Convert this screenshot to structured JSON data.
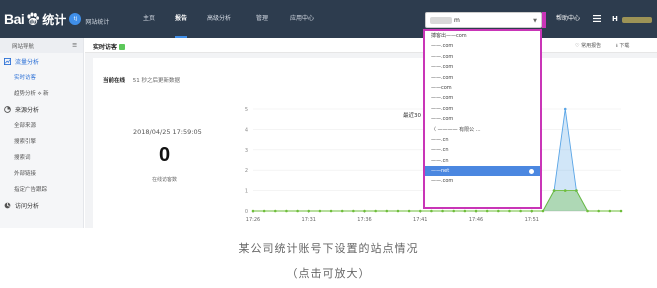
{
  "topbar": {
    "logo_text": "Bai",
    "logo_text2": "统计",
    "logo_badge": "tj",
    "logo_sub": "网站统计",
    "nav": [
      {
        "label": "主页",
        "active": false
      },
      {
        "label": "报告",
        "active": true
      },
      {
        "label": "高级分析",
        "active": false
      },
      {
        "label": "管理",
        "active": false
      },
      {
        "label": "应用中心",
        "active": false
      }
    ],
    "site_select_value": "m",
    "help": "帮助中心",
    "user_initial": "H"
  },
  "sidebar": {
    "header": "网站导航",
    "sections": [
      {
        "label": "流量分析",
        "icon": "chart-icon",
        "items": [
          "实时访客",
          "趋势分析 ⟡ 新"
        ]
      },
      {
        "label": "来源分析",
        "icon": "source-icon",
        "items": [
          "全部来源",
          "搜索引擎",
          "搜索词",
          "外部链接",
          "指定广告跟踪"
        ]
      },
      {
        "label": "访问分析",
        "icon": "visit-icon",
        "items": []
      }
    ],
    "active_item": "实时访客"
  },
  "toolbar": {
    "title": "实时访客",
    "right": [
      "♡ 常用报告",
      "⭳ 下载"
    ]
  },
  "realtime": {
    "online_label": "当前在线",
    "online_note": "51 秒之后更新数据",
    "time": "2018/04/25 17:59:05",
    "count": "0",
    "count_caption": "在线访客数"
  },
  "chart_data": {
    "type": "line",
    "title": "最近30",
    "x": [
      "17:26",
      "17:31",
      "17:36",
      "17:41",
      "17:46",
      "17:51"
    ],
    "ylim": [
      0,
      5
    ],
    "yticks": [
      "0",
      "1",
      "2",
      "3",
      "4",
      "5"
    ],
    "series": [
      {
        "values": [
          0,
          0,
          0,
          0,
          0,
          0,
          0,
          0,
          0,
          0,
          0,
          0,
          0,
          0,
          0,
          0,
          0,
          0,
          0,
          0,
          0,
          0,
          0,
          0,
          0,
          0,
          0,
          1,
          5,
          1,
          0,
          0,
          0,
          0
        ]
      },
      {
        "values": [
          0,
          0,
          0,
          0,
          0,
          0,
          0,
          0,
          0,
          0,
          0,
          0,
          0,
          0,
          0,
          0,
          0,
          0,
          0,
          0,
          0,
          0,
          0,
          0,
          0,
          0,
          0,
          1,
          1,
          1,
          0,
          0,
          0,
          0
        ]
      }
    ],
    "colors": {
      "blue": "#5aa5e6",
      "green": "#6ebd3a"
    }
  },
  "dropdown": {
    "items": [
      {
        "text": "搏客出——com",
        "selected": false
      },
      {
        "text": "——.com",
        "selected": false
      },
      {
        "text": "——.com",
        "selected": false
      },
      {
        "text": "——.com",
        "selected": false
      },
      {
        "text": "——.com",
        "selected": false
      },
      {
        "text": "——com",
        "selected": false
      },
      {
        "text": "——.com",
        "selected": false
      },
      {
        "text": "——.com",
        "selected": false
      },
      {
        "text": "——.com",
        "selected": false
      },
      {
        "text": "〈 ———— 有限公 ...",
        "selected": false
      },
      {
        "text": "——.cn",
        "selected": false
      },
      {
        "text": "——.cn",
        "selected": false
      },
      {
        "text": "——.cn",
        "selected": false
      },
      {
        "text": "——net",
        "selected": true
      },
      {
        "text": "——.com",
        "selected": false
      }
    ]
  },
  "caption": {
    "line1": "某公司统计账号下设置的站点情况",
    "line2": "（点击可放大）"
  }
}
